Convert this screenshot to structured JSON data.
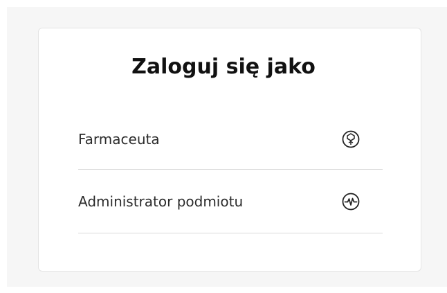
{
  "login": {
    "title": "Zaloguj się jako",
    "roles": [
      {
        "label": "Farmaceuta",
        "icon": "pharmacy-symbol-icon"
      },
      {
        "label": "Administrator podmiotu",
        "icon": "heartbeat-icon"
      }
    ]
  }
}
